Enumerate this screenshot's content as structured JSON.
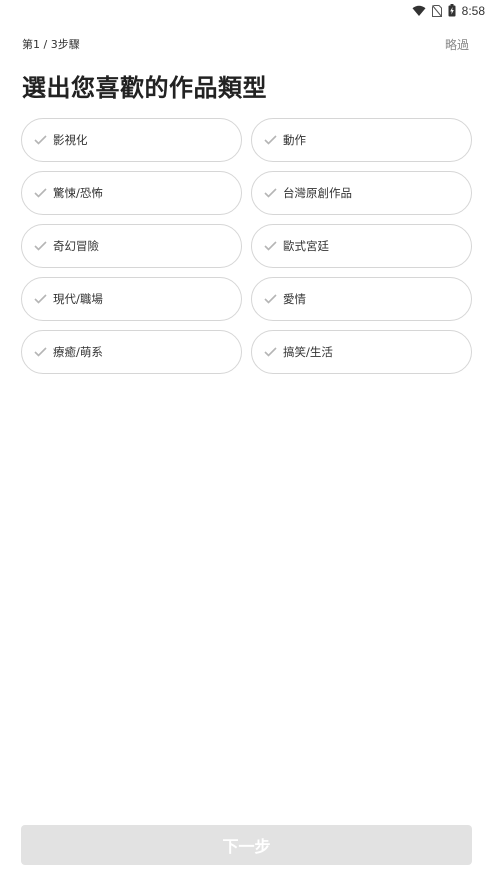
{
  "status_bar": {
    "time": "8:58",
    "icons": [
      "wifi-icon",
      "no-sim-icon",
      "battery-charging-icon"
    ]
  },
  "header": {
    "step": "第1 / 3步驟",
    "skip": "略過"
  },
  "title": "選出您喜歡的作品類型",
  "genres": [
    {
      "label": "影視化",
      "icon": "check-icon"
    },
    {
      "label": "動作",
      "icon": "check-icon"
    },
    {
      "label": "驚悚/恐怖",
      "icon": "check-icon"
    },
    {
      "label": "台灣原創作品",
      "icon": "check-icon"
    },
    {
      "label": "奇幻冒險",
      "icon": "check-icon"
    },
    {
      "label": "歐式宮廷",
      "icon": "check-icon"
    },
    {
      "label": "現代/職場",
      "icon": "check-icon"
    },
    {
      "label": "愛情",
      "icon": "check-icon"
    },
    {
      "label": "療癒/萌系",
      "icon": "check-icon"
    },
    {
      "label": "搞笑/生活",
      "icon": "check-icon"
    }
  ],
  "next_button": "下一步",
  "colors": {
    "chip_border": "#d6d6d6",
    "check": "#b5b5b5",
    "button_disabled": "#e2e2e2",
    "skip_text": "#888888"
  }
}
